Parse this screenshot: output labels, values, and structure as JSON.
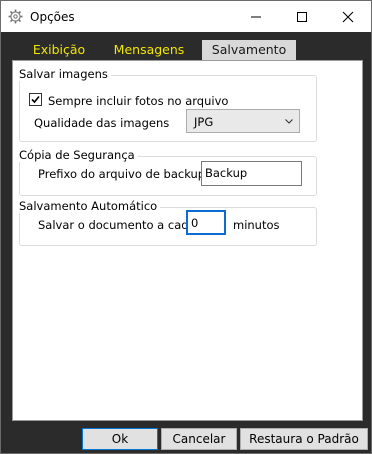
{
  "window": {
    "title": "Opções"
  },
  "tabs": [
    {
      "label": "Exibição",
      "active": false
    },
    {
      "label": "Mensagens",
      "active": false
    },
    {
      "label": "Salvamento",
      "active": true
    }
  ],
  "colors": {
    "tab_text": "#f2e600",
    "background": "#2b2b2b",
    "active_tab": "#d9d9d9",
    "focus": "#0b6dd1"
  },
  "save_images": {
    "title": "Salvar imagens",
    "include_photos_label": "Sempre incluir fotos no arquivo",
    "include_photos_checked": true,
    "quality_label": "Qualidade das imagens",
    "quality_value": "JPG"
  },
  "backup": {
    "title": "Cópia de Segurança",
    "prefix_label": "Prefixo do arquivo de backup:",
    "prefix_value": "Backup"
  },
  "autosave": {
    "title": "Salvamento Automático",
    "save_every_label": "Salvar o documento a cada",
    "minutes_value": "0",
    "minutes_unit": "minutos"
  },
  "buttons": {
    "ok": "Ok",
    "cancel": "Cancelar",
    "reset": "Restaura o Padrão"
  }
}
